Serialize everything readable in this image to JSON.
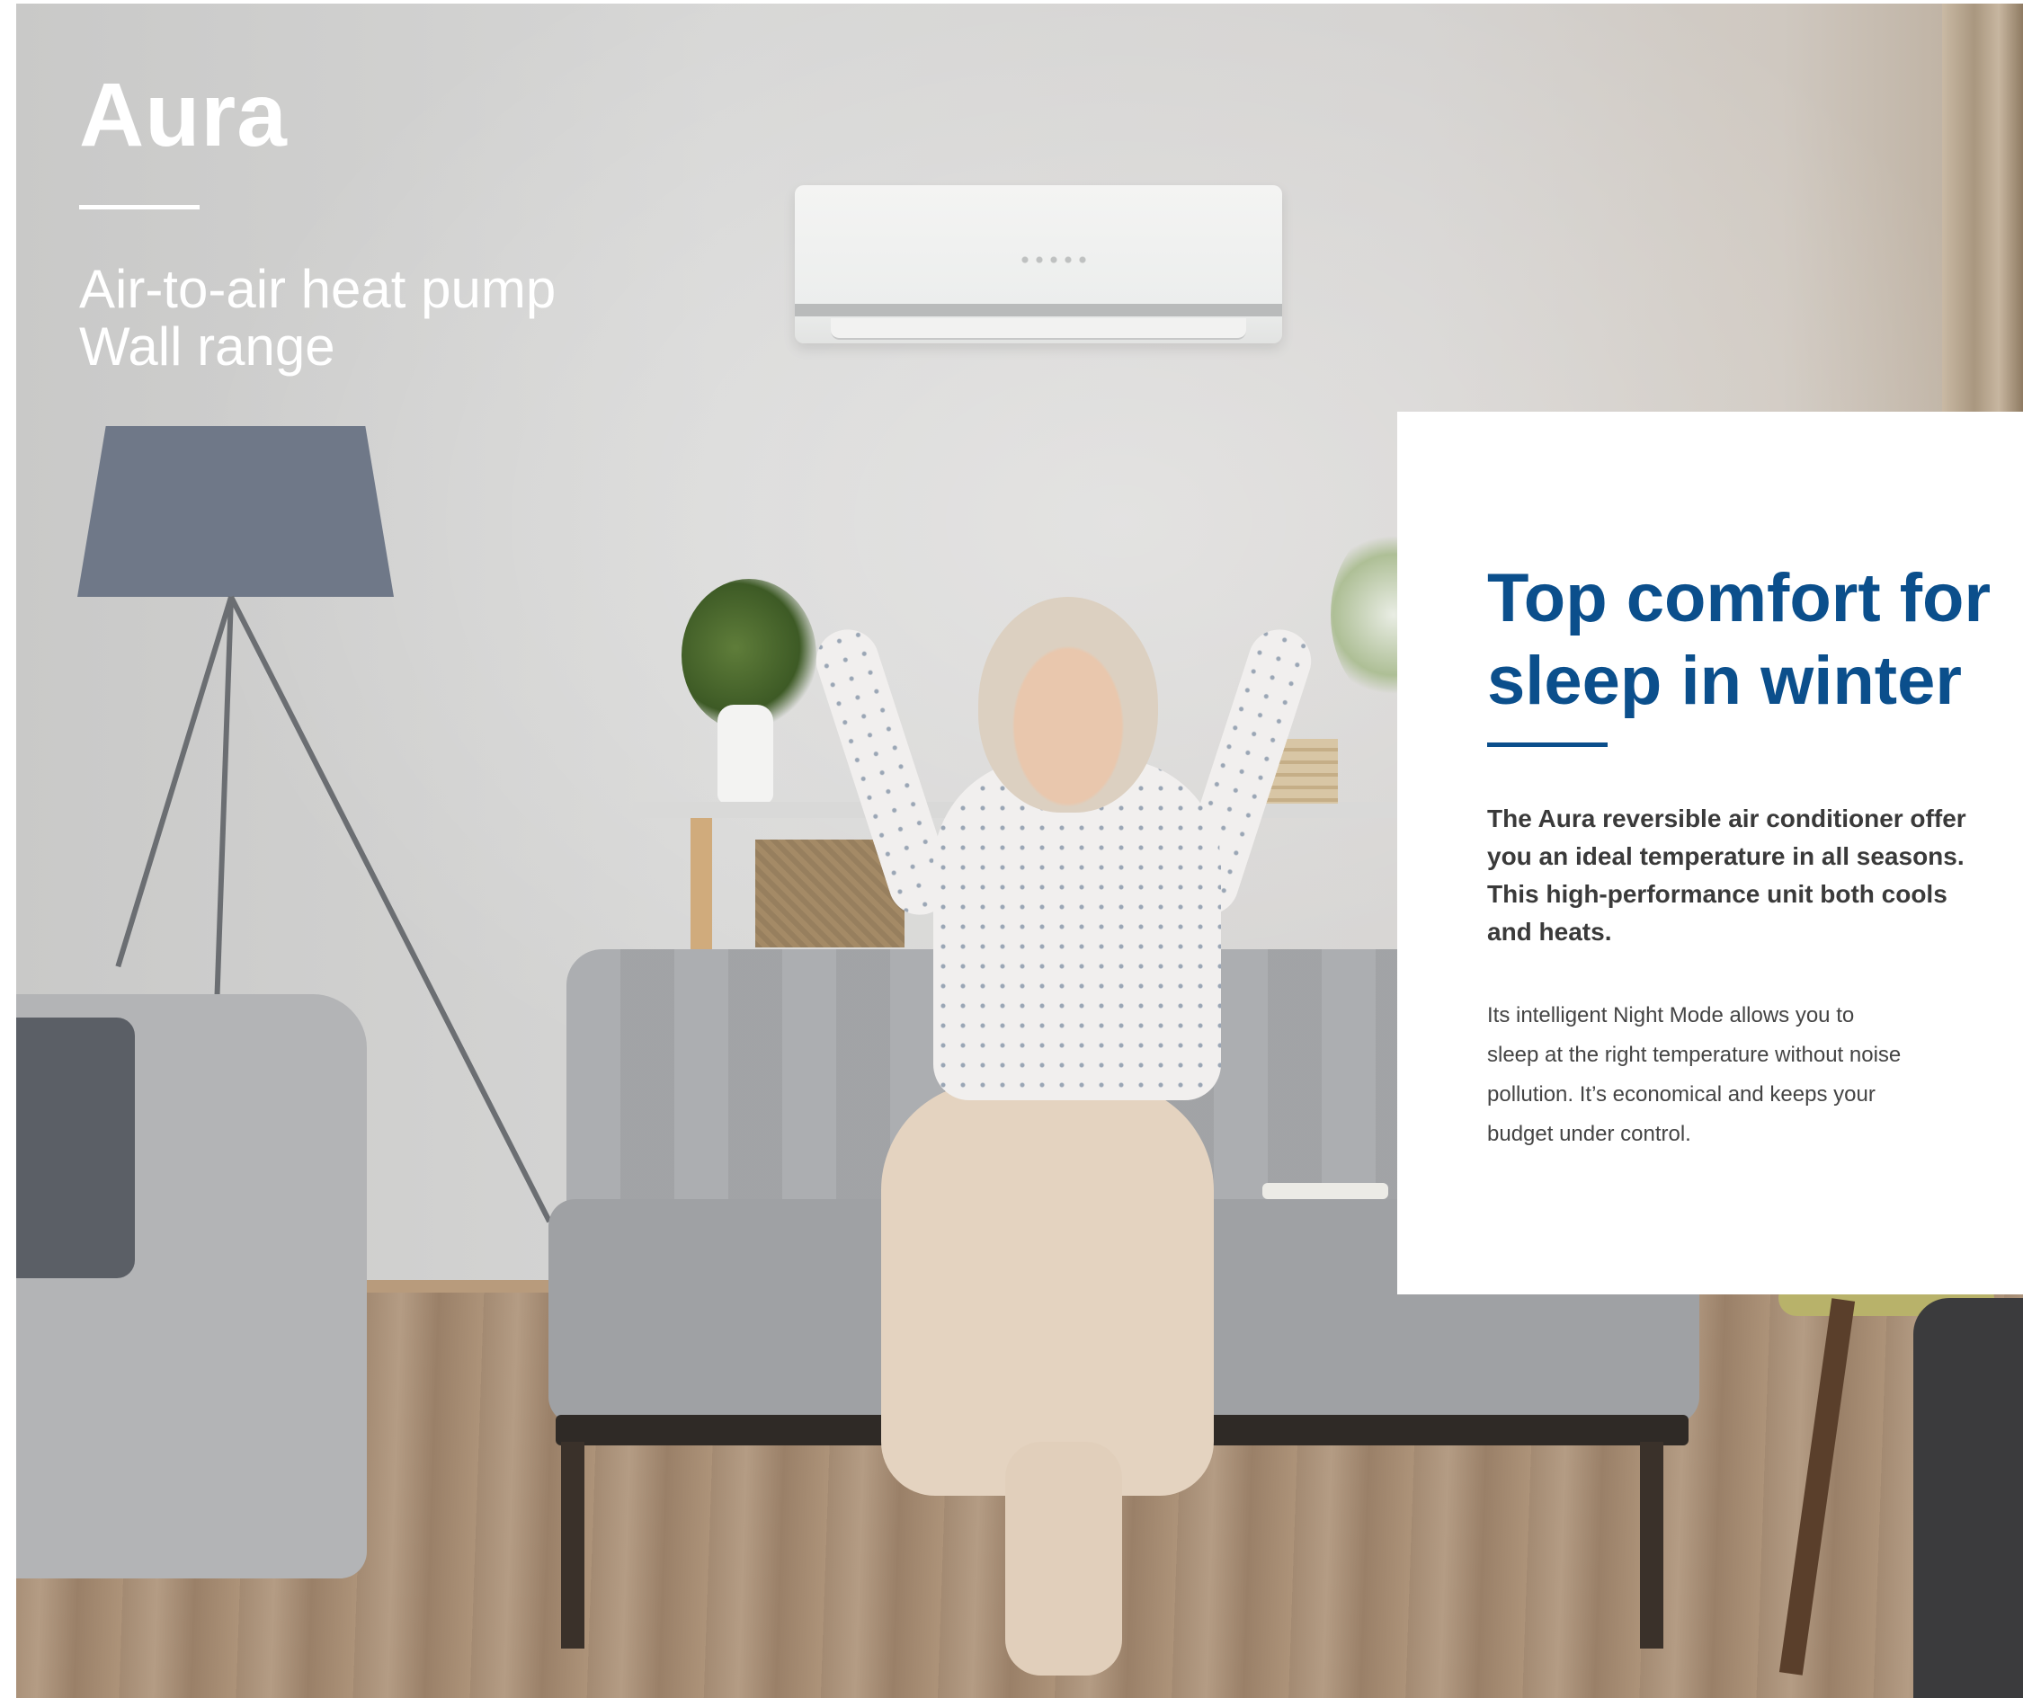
{
  "hero": {
    "title": "Aura",
    "subtitle_lines": [
      "Air-to-air heat pump",
      "Wall range"
    ]
  },
  "panel": {
    "title_lines": [
      "Top comfort for",
      "sleep in winter"
    ],
    "lead_lines": [
      "The Aura reversible air conditioner offer",
      "you an ideal temperature in all seasons.",
      "This high-performance unit both cools",
      "and heats."
    ],
    "body_lines": [
      "Its intelligent Night Mode allows you to",
      "sleep at the right temperature without noise",
      "pollution. It’s economical and keeps your",
      "budget under control."
    ]
  },
  "colors": {
    "accent_blue": "#0b4f8c",
    "hero_text": "#ffffff",
    "panel_bg": "#ffffff"
  }
}
